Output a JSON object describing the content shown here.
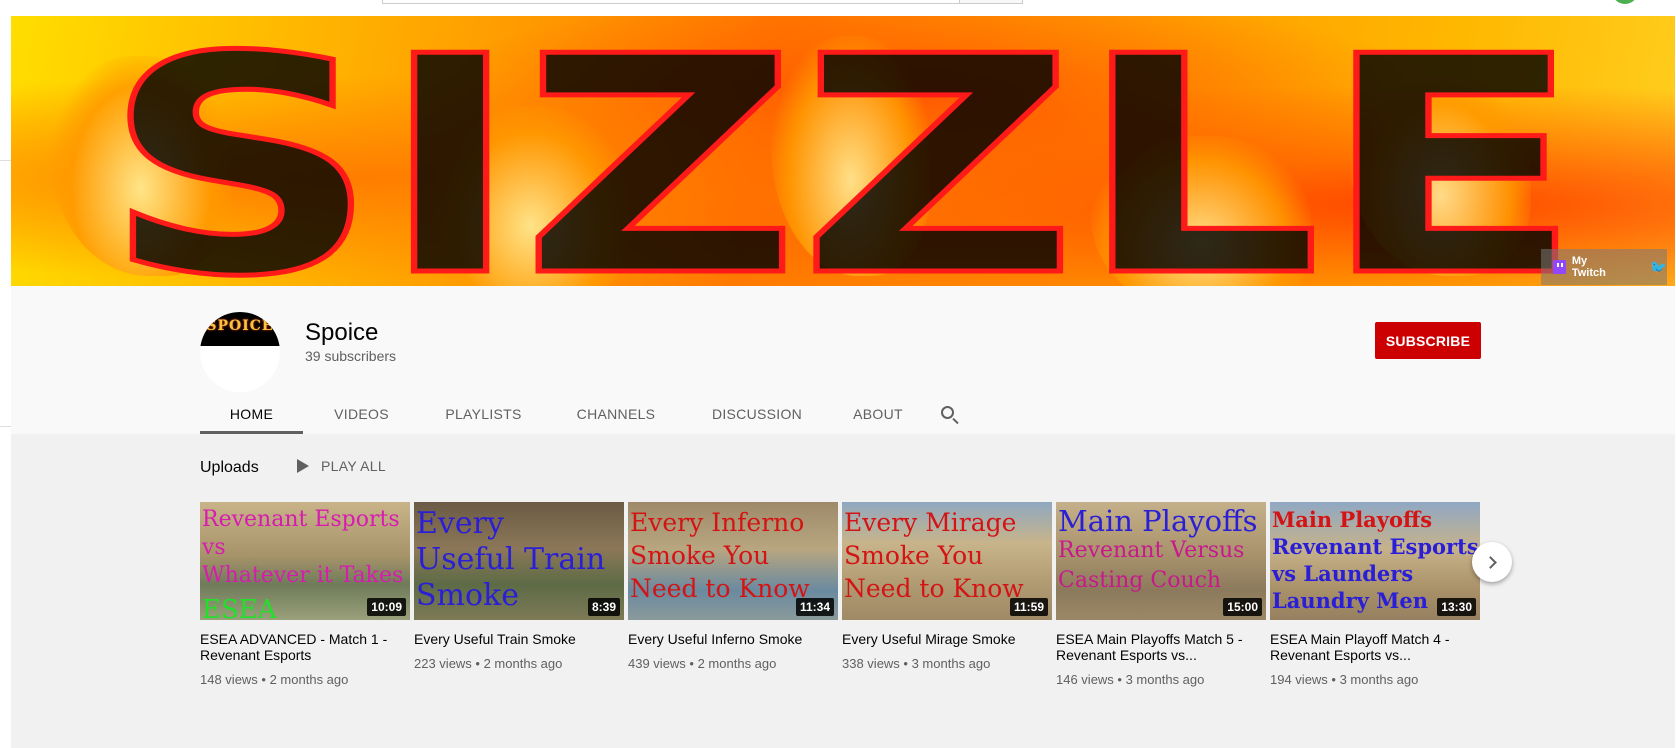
{
  "banner": {
    "logo_text": "SIZZLE",
    "links": {
      "twitch_label": "My Twitch"
    }
  },
  "channel": {
    "name": "Spoice",
    "avatar_text": "SPOICE",
    "subscribers": "39 subscribers",
    "subscribe_label": "SUBSCRIBE"
  },
  "tabs": [
    {
      "label": "HOME",
      "active": true
    },
    {
      "label": "VIDEOS"
    },
    {
      "label": "PLAYLISTS"
    },
    {
      "label": "CHANNELS"
    },
    {
      "label": "DISCUSSION"
    },
    {
      "label": "ABOUT"
    }
  ],
  "uploads": {
    "title": "Uploads",
    "play_all": "PLAY ALL",
    "videos": [
      {
        "title": "ESEA ADVANCED - Match 1 - Revenant Esports",
        "thumb_lines": [
          "Revenant Esports vs",
          "Whatever it Takes",
          "ESEA Advanced"
        ],
        "duration": "10:09",
        "views": "148 views",
        "age": "2 months ago"
      },
      {
        "title": "Every Useful Train Smoke",
        "thumb_lines": [
          "Every",
          "Useful Train",
          "Smoke"
        ],
        "duration": "8:39",
        "views": "223 views",
        "age": "2 months ago"
      },
      {
        "title": "Every Useful Inferno Smoke",
        "thumb_lines": [
          "Every Inferno",
          "Smoke You",
          "Need to Know"
        ],
        "duration": "11:34",
        "views": "439 views",
        "age": "2 months ago"
      },
      {
        "title": "Every Useful Mirage Smoke",
        "thumb_lines": [
          "Every Mirage",
          "Smoke You",
          "Need to Know"
        ],
        "duration": "11:59",
        "views": "338 views",
        "age": "3 months ago"
      },
      {
        "title": "ESEA Main Playoffs Match 5 - Revenant Esports vs...",
        "thumb_lines": [
          "Main Playoffs",
          "Revenant Versus",
          "Casting Couch"
        ],
        "duration": "15:00",
        "views": "146 views",
        "age": "3 months ago"
      },
      {
        "title": "ESEA Main Playoff Match 4 - Revenant Esports vs...",
        "thumb_lines": [
          "Main Playoffs",
          "Revenant Esports",
          "vs Launders",
          "Laundry Men"
        ],
        "duration": "13:30",
        "views": "194 views",
        "age": "3 months ago"
      }
    ]
  }
}
